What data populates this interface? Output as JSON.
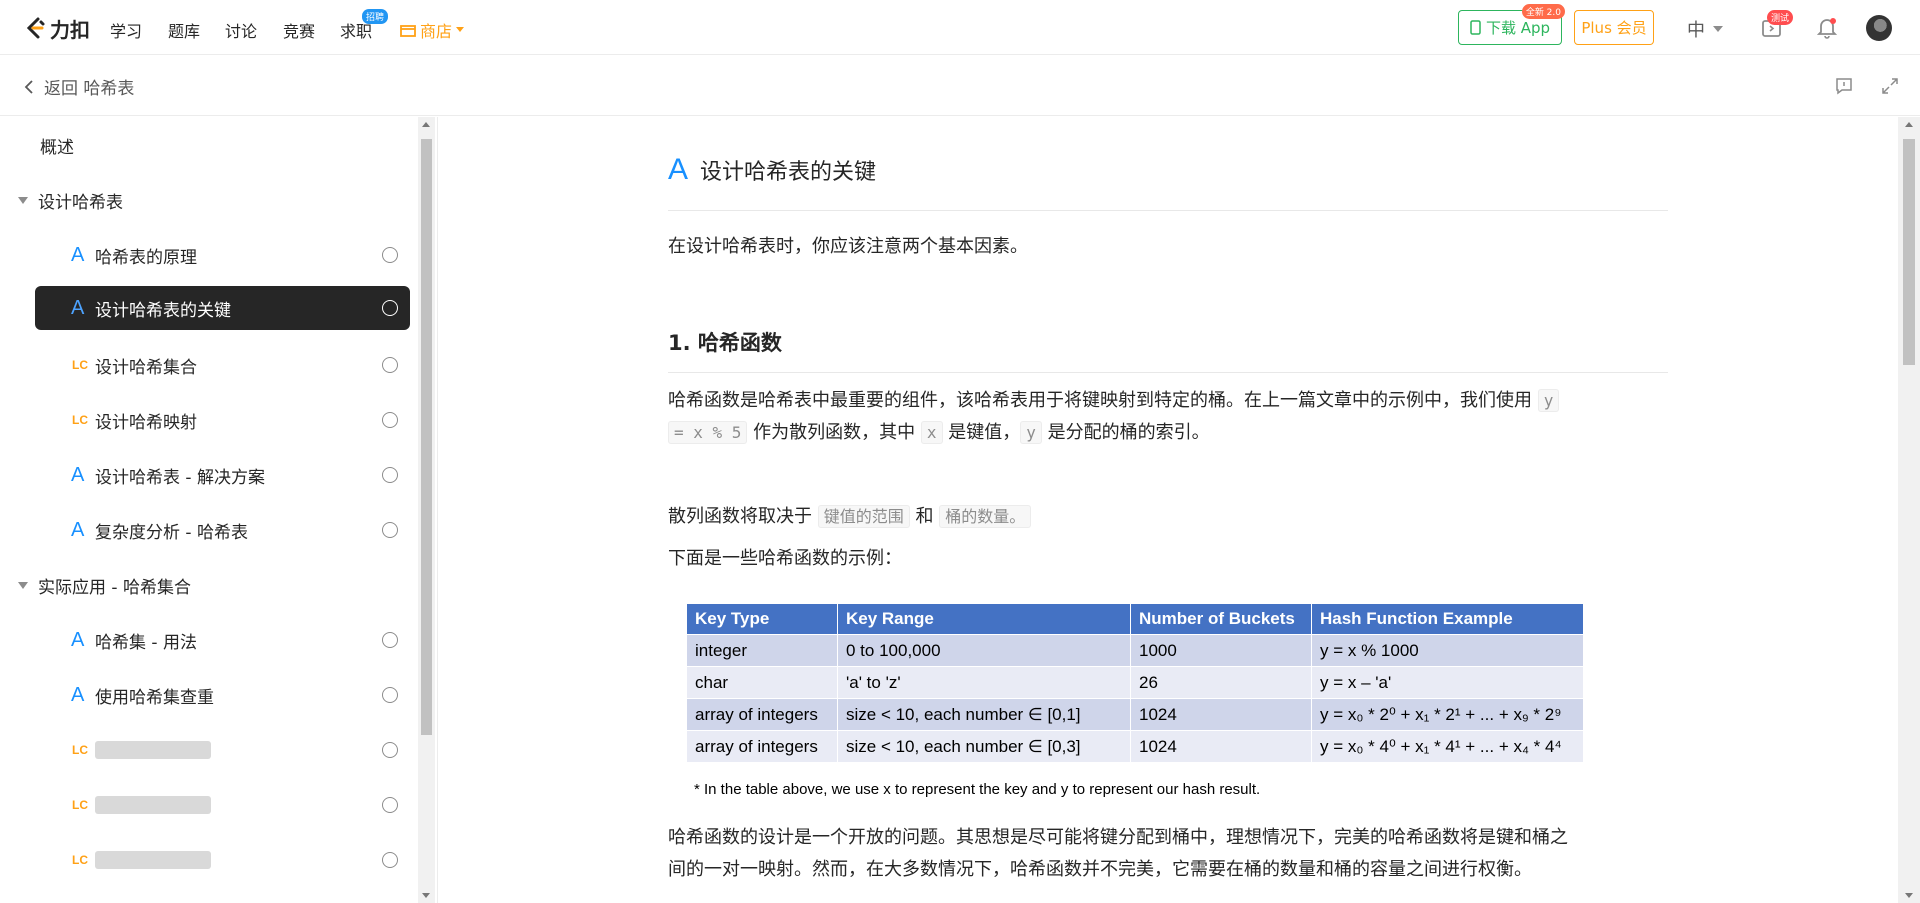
{
  "topnav": {
    "logo_text": "力扣",
    "items": [
      "学习",
      "题库",
      "讨论",
      "竞赛",
      "求职"
    ],
    "jobs_badge": "招聘",
    "shop_label": "商店",
    "download_label": "下载 App",
    "download_badge": "全新 2.0",
    "plus_label": "Plus 会员",
    "lang_label": "中",
    "ide_badge": "测试"
  },
  "subheader": {
    "back_label": "返回 哈希表"
  },
  "sidebar": {
    "overview": "概述",
    "sections": [
      {
        "title": "设计哈希表",
        "items": [
          {
            "tag": "A",
            "label": "哈希表的原理"
          },
          {
            "tag": "A",
            "label": "设计哈希表的关键"
          },
          {
            "tag": "LC",
            "label": "设计哈希集合"
          },
          {
            "tag": "LC",
            "label": "设计哈希映射"
          },
          {
            "tag": "A",
            "label": "设计哈希表 - 解决方案"
          },
          {
            "tag": "A",
            "label": "复杂度分析 - 哈希表"
          }
        ]
      },
      {
        "title": "实际应用 - 哈希集合",
        "items": [
          {
            "tag": "A",
            "label": "哈希集 - 用法"
          },
          {
            "tag": "A",
            "label": "使用哈希集查重"
          },
          {
            "tag": "LC",
            "label": ""
          },
          {
            "tag": "LC",
            "label": ""
          },
          {
            "tag": "LC",
            "label": ""
          }
        ]
      }
    ]
  },
  "article": {
    "title_tag": "A",
    "title": "设计哈希表的关键",
    "intro": "在设计哈希表时，你应该注意两个基本因素。",
    "h2": "1. 哈希函数",
    "p1_a": "哈希函数是哈希表中最重要的组件，该哈希表用于将键映射到特定的桶。在上一篇文章中的示例中，我们使用 ",
    "p1_code1a": "y",
    "p1_code1b": "= x % 5",
    "p1_b": " 作为散列函数，其中 ",
    "p1_code2": "x",
    "p1_c": " 是键值，",
    "p1_code3": "y",
    "p1_d": " 是分配的桶的索引。",
    "p2_a": "散列函数将取决于 ",
    "p2_code1": "键值的范围",
    "p2_b": " 和 ",
    "p2_code2": "桶的数量。",
    "p3": "下面是一些哈希函数的示例：",
    "table": {
      "headers": [
        "Key Type",
        "Key Range",
        "Number of Buckets",
        "Hash Function Example"
      ],
      "rows": [
        [
          "integer",
          "0 to 100,000",
          "1000",
          "y = x % 1000"
        ],
        [
          "char",
          "'a' to 'z'",
          "26",
          "y = x – 'a'"
        ],
        [
          "array of integers",
          "size < 10, each number ∈ [0,1]",
          "1024",
          "y = x₀ * 2⁰ + x₁ * 2¹ + ... + x₉ * 2⁹"
        ],
        [
          "array of integers",
          "size < 10, each number ∈ [0,3]",
          "1024",
          "y = x₀ * 4⁰ + x₁ * 4¹ + ... + x₄ * 4⁴"
        ]
      ],
      "note": "* In the table above, we use x to represent the key and y to represent our hash result."
    },
    "p4_line1": "哈希函数的设计是一个开放的问题。其思想是尽可能将键分配到桶中，理想情况下，完美的哈希函数将是键和桶之",
    "p4_line2": "间的一对一映射。然而，在大多数情况下，哈希函数并不完美，它需要在桶的数量和桶的容量之间进行权衡。"
  },
  "colors": {
    "accent_orange": "#ffa116",
    "accent_green": "#2db55d",
    "accent_blue": "#1890ff",
    "table_header": "#4472c4"
  }
}
